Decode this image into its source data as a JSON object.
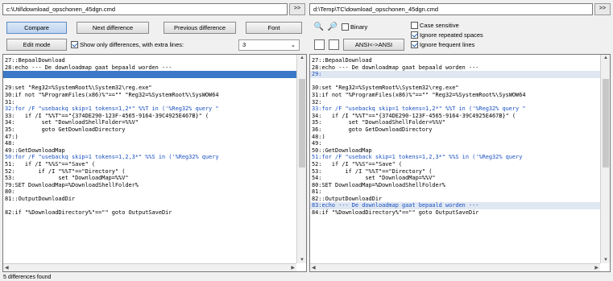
{
  "left_path": "c:\\Util\\download_opschonen_45dgn.cmd",
  "right_path": "d:\\Temp\\TC\\download_opschonen_45dgn.cmd",
  "swap_label": ">>",
  "swap_label_right": ">>",
  "toolbar": {
    "compare": "Compare",
    "next_diff": "Next difference",
    "prev_diff": "Previous difference",
    "font": "Font",
    "edit_mode": "Edit mode",
    "show_only_diff": "Show only differences, with extra lines:",
    "extra_lines_value": "3",
    "binary": "Binary",
    "ansi": "ANSI<->ANSI",
    "case_sensitive": "Case sensitive",
    "ignore_repeated": "Ignore repeated spaces",
    "ignore_frequent": "Ignore frequent lines"
  },
  "options_state": {
    "show_only_diff": true,
    "binary": false,
    "case_sensitive": false,
    "ignore_repeated": true,
    "ignore_frequent": true
  },
  "left_lines": [
    {
      "t": "27::BepaalDownload",
      "s": "n"
    },
    {
      "t": "28:echo --- De downloadmap gaat bepaald worden ---",
      "s": "n"
    },
    {
      "t": "",
      "s": "sel"
    },
    {
      "t": "",
      "s": "n"
    },
    {
      "t": "29:set \"Reg32=%SystemRoot%\\System32\\reg.exe\"",
      "s": "n"
    },
    {
      "t": "30:if not \"%ProgramFiles(x86)%\"==\"\" \"Reg32=%SystemRoot%\\SysWOW64",
      "s": "n"
    },
    {
      "t": "31:",
      "s": "n"
    },
    {
      "t": "32:for /F \"usebackq skip=1 tokens=1,2*\" %%T in ('%Reg32% query \"",
      "s": "mod"
    },
    {
      "t": "33:   if /I \"%%T\"==\"{374DE290-123F-4565-9164-39C4925E467B}\" (",
      "s": "n"
    },
    {
      "t": "34:        set \"DownloadShellFolder=%%V\"",
      "s": "n"
    },
    {
      "t": "35:        goto GetDownloadDirectory",
      "s": "n"
    },
    {
      "t": "47:)",
      "s": "n"
    },
    {
      "t": "48:",
      "s": "n"
    },
    {
      "t": "49::GetDownloadMap",
      "s": "n"
    },
    {
      "t": "50:for /F \"usebackq skip=1 tokens=1,2,3*\" %%S in ('%Reg32% query",
      "s": "mod"
    },
    {
      "t": "51:   if /I \"%%S\"==\"Save\" (",
      "s": "n"
    },
    {
      "t": "52:       if /I \"%%T\"==\"Directory\" (",
      "s": "n"
    },
    {
      "t": "53:             set \"DownloadMap=%%V\"",
      "s": "n"
    },
    {
      "t": "79:SET DownloadMap=%DownloadShellFolder%",
      "s": "n"
    },
    {
      "t": "80:",
      "s": "n"
    },
    {
      "t": "81::OutputDownloadDir",
      "s": "n"
    },
    {
      "t": "",
      "s": "n"
    },
    {
      "t": "82:if \"%DownloadDirectory%\"==\"\" goto OutputSaveDir",
      "s": "n"
    }
  ],
  "right_lines": [
    {
      "t": "27::BepaalDownload",
      "s": "n"
    },
    {
      "t": "28:echo --- De downloadmap gaat bepaald worden ---",
      "s": "n"
    },
    {
      "t": "29:",
      "s": "add"
    },
    {
      "t": "",
      "s": "n"
    },
    {
      "t": "30:set \"Reg32=%SystemRoot%\\System32\\reg.exe\"",
      "s": "n"
    },
    {
      "t": "31:if not \"%ProgramFiles(x86)%\"==\"\" \"Reg32=%SystemRoot%\\SysWOW64",
      "s": "n"
    },
    {
      "t": "32:",
      "s": "n"
    },
    {
      "t": "33:for /F \"usebackq skip=1 tokens=1,2*\" %%T in ('%Reg32% query \"",
      "s": "mod"
    },
    {
      "t": "34:   if /I \"%%T\"==\"{374DE290-123F-4565-9164-39C4925E467B}\" (",
      "s": "n"
    },
    {
      "t": "35:        set \"DownloadShellFolder=%%V\"",
      "s": "n"
    },
    {
      "t": "36:        goto GetDownloadDirectory",
      "s": "n"
    },
    {
      "t": "48:)",
      "s": "n"
    },
    {
      "t": "49:",
      "s": "n"
    },
    {
      "t": "50::GetDownloadMap",
      "s": "n"
    },
    {
      "t": "51:for /F \"useback skip=1 tokens=1,2,3*\" %%S in ('%Reg32% query",
      "s": "mod"
    },
    {
      "t": "52:   if /I \"%%S\"==\"Save\" (",
      "s": "n"
    },
    {
      "t": "53:       if /I \"%%T\"==\"Directory\" (",
      "s": "n"
    },
    {
      "t": "54:             set \"DownloadMap=%%V\"",
      "s": "n"
    },
    {
      "t": "80:SET DownloadMap=%DownloadShellFolder%",
      "s": "n"
    },
    {
      "t": "81:",
      "s": "n"
    },
    {
      "t": "82::OutputDownloadDir",
      "s": "n"
    },
    {
      "t": "83:echo --- De downloadmap gaat bepaald worden ---",
      "s": "add"
    },
    {
      "t": "84:if \"%DownloadDirectory%\"==\"\" goto OutputSaveDir",
      "s": "n"
    }
  ],
  "status": "5 differences found",
  "colors": {
    "selected": "#3c78c8",
    "changed_text": "#1a50c0",
    "added_bg": "#dfe7f2"
  }
}
